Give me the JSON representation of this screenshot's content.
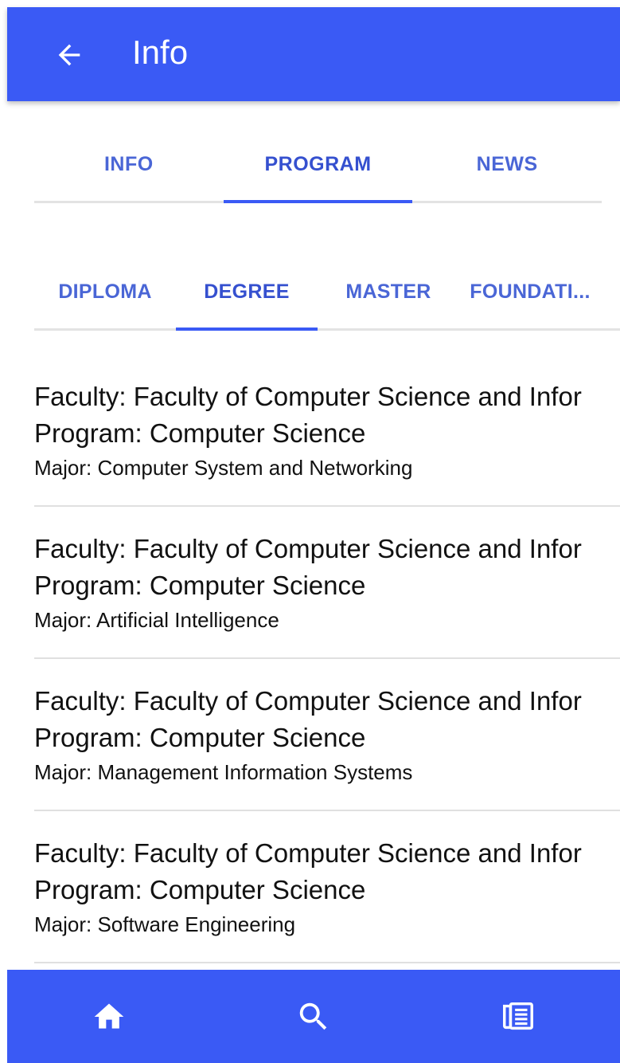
{
  "appbar": {
    "title": "Info",
    "back_icon": "arrow-left-icon"
  },
  "main_tabs": [
    {
      "label": "INFO",
      "active": false
    },
    {
      "label": "PROGRAM",
      "active": true
    },
    {
      "label": "NEWS",
      "active": false
    }
  ],
  "sub_tabs": [
    {
      "label": "DIPLOMA",
      "active": false
    },
    {
      "label": "DEGREE",
      "active": true
    },
    {
      "label": "MASTER",
      "active": false
    },
    {
      "label": "FOUNDATI...",
      "active": false
    }
  ],
  "programs": [
    {
      "faculty": "Faculty: Faculty of Computer Science and Infor",
      "program": "Program: Computer Science",
      "major": "Major: Computer System and Networking"
    },
    {
      "faculty": "Faculty: Faculty of Computer Science and Infor",
      "program": "Program: Computer Science",
      "major": "Major: Artificial Intelligence"
    },
    {
      "faculty": "Faculty: Faculty of Computer Science and Infor",
      "program": "Program: Computer Science",
      "major": "Major: Management Information Systems"
    },
    {
      "faculty": "Faculty: Faculty of Computer Science and Infor",
      "program": "Program: Computer Science",
      "major": "Major: Software Engineering"
    }
  ],
  "bottom_nav": [
    {
      "icon": "home-icon"
    },
    {
      "icon": "search-icon"
    },
    {
      "icon": "news-icon"
    }
  ],
  "colors": {
    "primary": "#3a5af5",
    "tab_text": "#4a66d6",
    "text": "#111111"
  }
}
